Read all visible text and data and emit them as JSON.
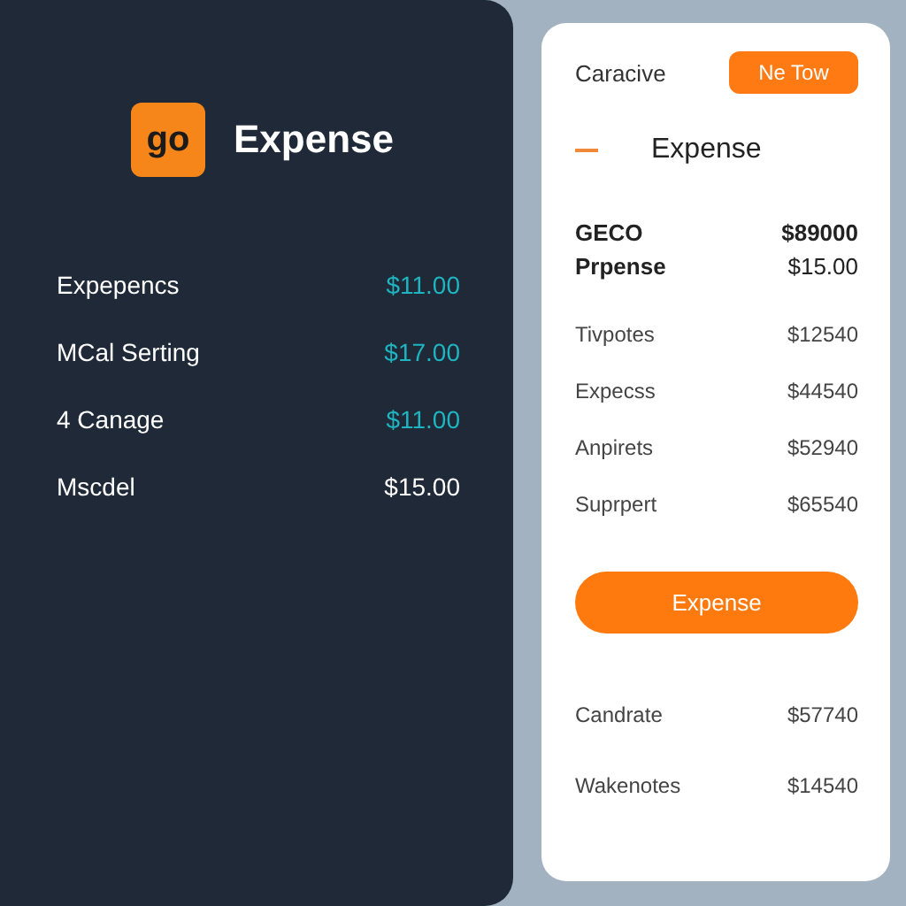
{
  "left_panel": {
    "logo": "go",
    "title": "Expense",
    "rows": [
      {
        "label": "Expepencs",
        "amount": "$11.00",
        "color": "#1fb5c0"
      },
      {
        "label": "MCal Serting",
        "amount": "$17.00",
        "color": "#1fb5c0"
      },
      {
        "label": "4 Canage",
        "amount": "$11.00",
        "color": "#1fb5c0"
      },
      {
        "label": "Mscdel",
        "amount": "$15.00",
        "color": "#ffffff"
      }
    ]
  },
  "right_card": {
    "header_label": "Caracive",
    "header_button": "Ne Tow",
    "title": "Expense",
    "summary": [
      {
        "label": "GECO",
        "amount": "$89000"
      },
      {
        "label": "Prpense",
        "amount": "$15.00"
      }
    ],
    "rows": [
      {
        "label": "Tivpotes",
        "amount": "$12540"
      },
      {
        "label": "Expecss",
        "amount": "$44540"
      },
      {
        "label": "Anpirets",
        "amount": "$52940"
      },
      {
        "label": "Suprpert",
        "amount": "$65540"
      }
    ],
    "action_button": "Expense",
    "footer_rows": [
      {
        "label": "Candrate",
        "amount": "$57740"
      },
      {
        "label": "Wakenotes",
        "amount": "$14540"
      }
    ]
  }
}
